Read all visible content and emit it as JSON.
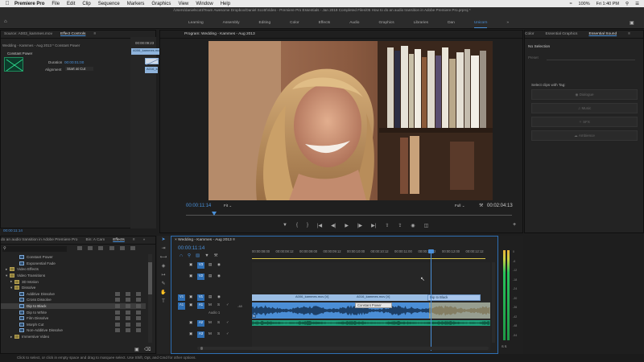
{
  "menubar": {
    "app_name": "Premiere Pro",
    "items": [
      "File",
      "Edit",
      "Clip",
      "Sequence",
      "Markers",
      "Graphics",
      "View",
      "Window",
      "Help"
    ],
    "status_right": [
      "100%",
      "Fri 1:40 PM"
    ]
  },
  "window": {
    "path": "/Users/danielscott/Team Awesome Dropbox/Daniel Scott/Video - Premiere Pro Essentials - Jan 2019 Completed Files/05 How to do an audio transition in Adobe Premiere Pro.prproj *",
    "workspaces": [
      "Learning",
      "Assembly",
      "Editing",
      "Color",
      "Effects",
      "Audio",
      "Graphics",
      "Libraries",
      "Dan",
      "Unicorn"
    ],
    "active_workspace": "Unicorn"
  },
  "source_panel": {
    "tabs": [
      "Source: A003_kammes.mov",
      "Effect Controls"
    ],
    "active_tab": "Effect Controls",
    "clip_label": "Wedding - Kammes - Aug 2013 * Constant Power",
    "effect_name": "Constant Power",
    "duration_label": "Duration",
    "duration_value": "00:00:01:00",
    "alignment_label": "Alignment",
    "alignment_value": "Start at Cut",
    "ruler_time": "00:00:09:23",
    "clip_a": "A006_kammes.mov",
    "clip_b": "A016_kammes",
    "timecode": "00:00:11:14"
  },
  "program_monitor": {
    "title": "Program: Wedding - Kammes - Aug 2013",
    "timecode": "00:00:11:14",
    "fit": "Fit",
    "quality": "Full",
    "duration": "00:02:04:13"
  },
  "right_panel": {
    "tabs": [
      "Color",
      "Essential Graphics",
      "Essential Sound"
    ],
    "active_tab": "Essential Sound",
    "no_selection": "No Selection",
    "preset_label": "Preset",
    "hint": "Select clips with Tag:",
    "buttons": [
      "Dialogue",
      "Music",
      "SFX",
      "Ambience"
    ]
  },
  "project_panel": {
    "tabs": [
      "do an audio transition in Adobe Premiere Pro",
      "Bin: A Cam",
      "Effects"
    ],
    "active_tab": "Effects",
    "items": [
      {
        "label": "Constant Power",
        "indent": 2,
        "type": "fx"
      },
      {
        "label": "Exponential Fade",
        "indent": 2,
        "type": "fx"
      },
      {
        "label": "Video Effects",
        "indent": 0,
        "type": "folder"
      },
      {
        "label": "Video Transitions",
        "indent": 0,
        "type": "folder-open"
      },
      {
        "label": "3D Motion",
        "indent": 1,
        "type": "folder"
      },
      {
        "label": "Dissolve",
        "indent": 1,
        "type": "folder-open"
      },
      {
        "label": "Additive Dissolve",
        "indent": 2,
        "type": "fx"
      },
      {
        "label": "Cross Dissolve",
        "indent": 2,
        "type": "fx"
      },
      {
        "label": "Dip to Black",
        "indent": 2,
        "type": "fx",
        "selected": true
      },
      {
        "label": "Dip to White",
        "indent": 2,
        "type": "fx"
      },
      {
        "label": "Film Dissolve",
        "indent": 2,
        "type": "fx"
      },
      {
        "label": "Morph Cut",
        "indent": 2,
        "type": "fx"
      },
      {
        "label": "Non-Additive Dissolve",
        "indent": 2,
        "type": "fx"
      },
      {
        "label": "Immersive Video",
        "indent": 1,
        "type": "folder"
      }
    ]
  },
  "timeline": {
    "title": "Wedding - Kammes - Aug 2013",
    "timecode": "00:00:11:14",
    "ruler": [
      "00:00:08:00",
      "00:00:08:12",
      "00:00:09:00",
      "00:00:09:12",
      "00:00:10:00",
      "00:00:10:12",
      "00:00:11:00",
      "00:00:11:12",
      "00:00:12:00",
      "00:00:12:12"
    ],
    "tracks": [
      "V3",
      "V2",
      "V1",
      "A1",
      "A2",
      "A3"
    ],
    "track_name_a1": "Audio 1",
    "clip_v1_a": "A006_kammes.mov [V]",
    "clip_v1_b": "A016_kammes.mov [V]",
    "transition_video": "Dip to Black",
    "transition_audio": "Constant Power",
    "level_min": "-48",
    "meter_db": [
      "0",
      "-6",
      "-12",
      "-18",
      "-24",
      "-30",
      "-36",
      "-42",
      "-48",
      "-54"
    ]
  },
  "status": {
    "text": "Click to select, or click in empty space and drag to marquee select. Use Shift, Opt, and Cmd for other options."
  },
  "colors": {
    "accent": "#4a90d9",
    "video_clip": "#8fb4dc",
    "audio_clip": "#4b8ed6",
    "audio_a2": "#1fa37c",
    "playhead": "#4a90d9",
    "workarea": "#d9c54a"
  }
}
